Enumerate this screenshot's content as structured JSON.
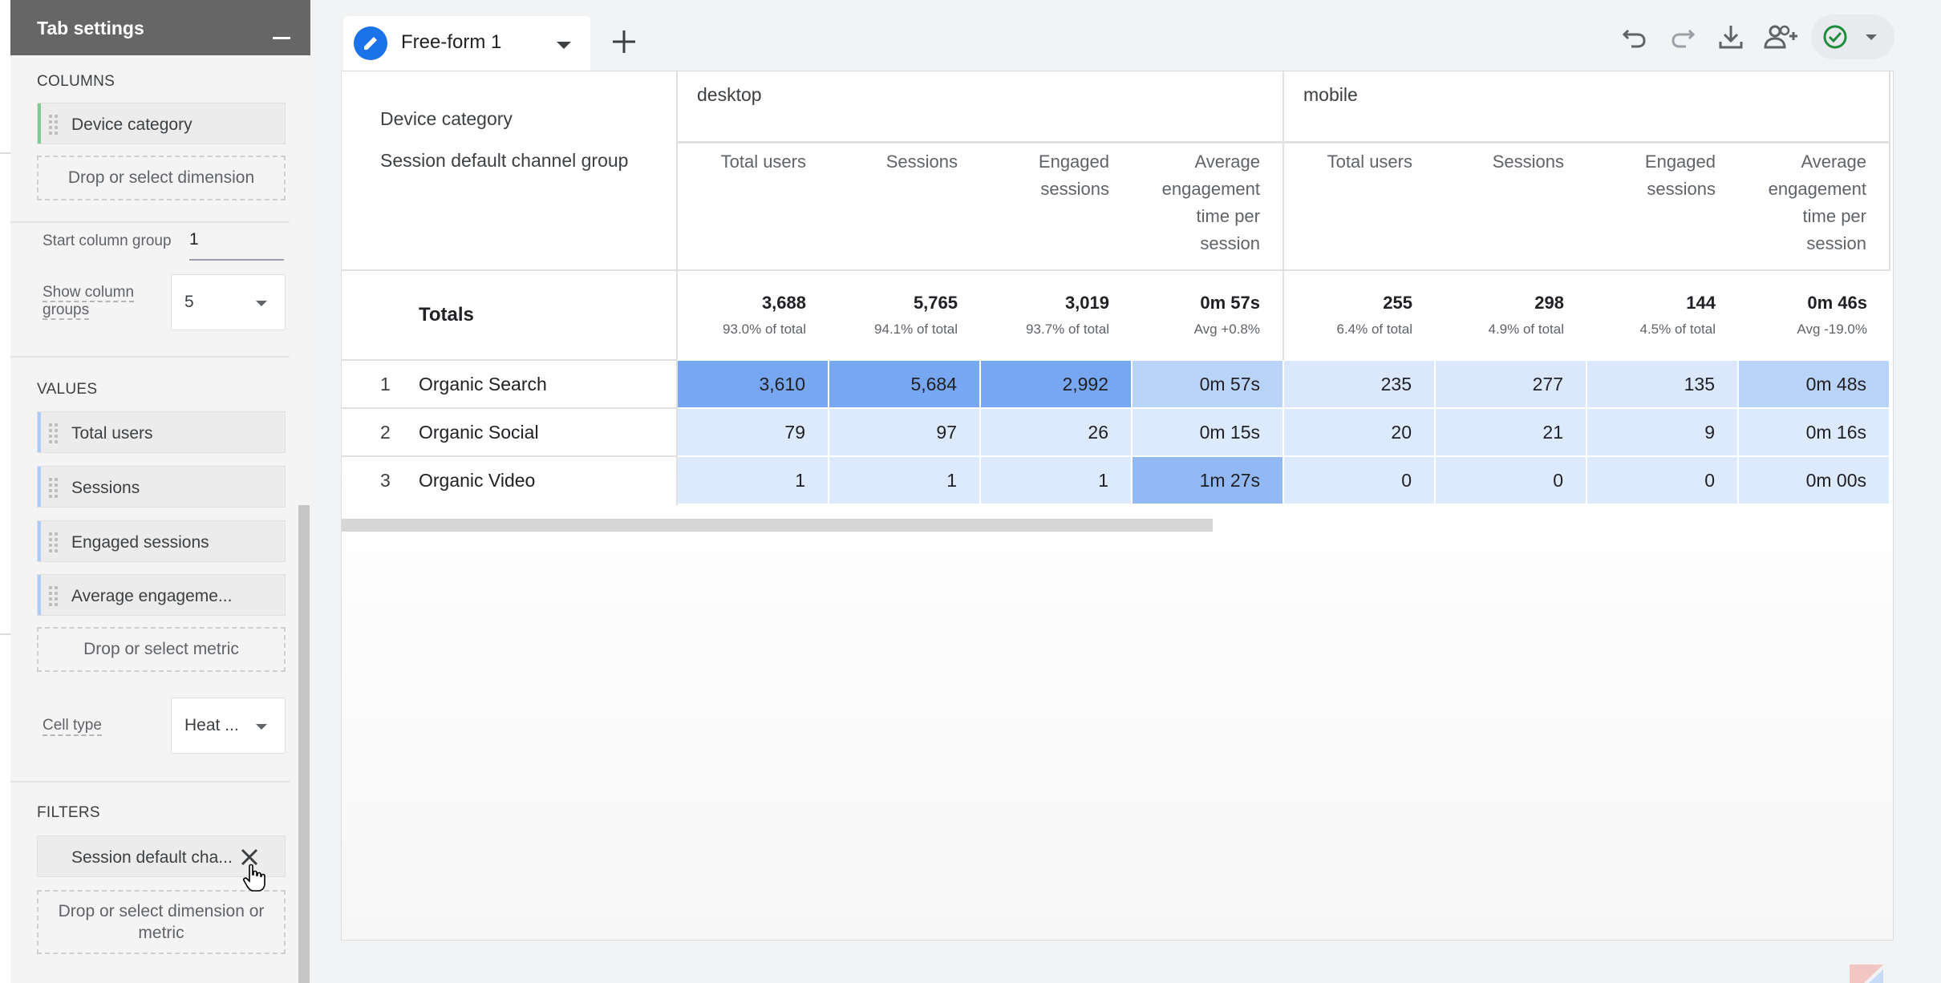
{
  "panel": {
    "title": "Tab settings",
    "columns": {
      "label": "COLUMNS",
      "chips": [
        {
          "label": "Device category",
          "color": "#81c995"
        }
      ],
      "drop_label": "Drop or select dimension",
      "start_column_group_label": "Start column group",
      "start_column_group_value": "1",
      "show_column_groups_label": "Show column groups",
      "show_column_groups_value": "5"
    },
    "values": {
      "label": "VALUES",
      "chips": [
        {
          "label": "Total users",
          "color": "#aecbfa"
        },
        {
          "label": "Sessions",
          "color": "#aecbfa"
        },
        {
          "label": "Engaged sessions",
          "color": "#aecbfa"
        },
        {
          "label": "Average engageme...",
          "color": "#aecbfa"
        }
      ],
      "drop_label": "Drop or select metric",
      "cell_type_label": "Cell type",
      "cell_type_value": "Heat ..."
    },
    "filters": {
      "label": "FILTERS",
      "chip_label": "Session default cha...",
      "drop_label": "Drop or select dimension or metric"
    }
  },
  "topbar": {
    "tab_label": "Free-form 1",
    "icons": [
      "undo-icon",
      "redo-icon",
      "download-icon",
      "share-icon",
      "check-circle-icon"
    ]
  },
  "report": {
    "col_dimension": "Device category",
    "row_dimension": "Session default channel group",
    "groups": [
      "desktop",
      "mobile"
    ],
    "metrics": [
      [
        "Total users"
      ],
      [
        "Sessions"
      ],
      [
        "Engaged",
        "sessions"
      ],
      [
        "Average",
        "engagement",
        "time per",
        "session"
      ]
    ],
    "totals_label": "Totals",
    "totals": [
      {
        "v": "3,688",
        "s": "93.0% of total"
      },
      {
        "v": "5,765",
        "s": "94.1% of total"
      },
      {
        "v": "3,019",
        "s": "93.7% of total"
      },
      {
        "v": "0m 57s",
        "s": "Avg +0.8%"
      },
      {
        "v": "255",
        "s": "6.4% of total"
      },
      {
        "v": "298",
        "s": "4.9% of total"
      },
      {
        "v": "144",
        "s": "4.5% of total"
      },
      {
        "v": "0m 46s",
        "s": "Avg -19.0%"
      }
    ],
    "rows": [
      {
        "idx": "1",
        "name": "Organic Search",
        "cells": [
          "3,610",
          "5,684",
          "2,992",
          "0m 57s",
          "235",
          "277",
          "135",
          "0m 48s"
        ],
        "heat": [
          1.0,
          1.0,
          1.0,
          0.4,
          0.12,
          0.12,
          0.12,
          0.4
        ]
      },
      {
        "idx": "2",
        "name": "Organic Social",
        "cells": [
          "79",
          "97",
          "26",
          "0m 15s",
          "20",
          "21",
          "9",
          "0m 16s"
        ],
        "heat": [
          0.1,
          0.1,
          0.1,
          0.1,
          0.1,
          0.1,
          0.1,
          0.1
        ]
      },
      {
        "idx": "3",
        "name": "Organic Video",
        "cells": [
          "1",
          "1",
          "1",
          "1m 27s",
          "0",
          "0",
          "0",
          "0m 00s"
        ],
        "heat": [
          0.1,
          0.1,
          0.1,
          0.75,
          0.1,
          0.1,
          0.1,
          0.1
        ]
      }
    ]
  },
  "colors": {
    "accent": "#1a73e8",
    "heat_max": "#76a7f0",
    "heat_min": "#e8f0fe",
    "check": "#1e8e3e"
  }
}
